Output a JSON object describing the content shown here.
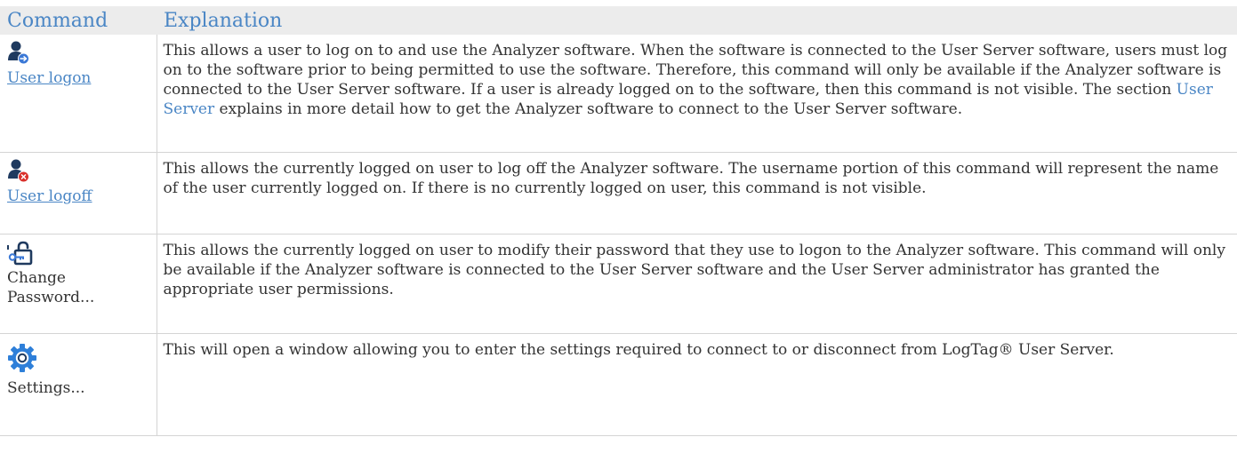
{
  "table": {
    "header": {
      "command": "Command",
      "explanation": "Explanation"
    },
    "rows": [
      {
        "command": "User logon",
        "icon": "user-logon-icon",
        "explanation_before": "This allows a user to log on to and use the Analyzer software. When the software is connected to the User Server software, users must log on to the software prior to being permitted to use the software. Therefore, this command will only be available if the Analyzer software is connected to the User Server software. If a user is already logged on to the software, then this command is not visible. The section ",
        "link": "User Server",
        "explanation_after": " explains in more detail how to get the Analyzer software to connect to the User Server software."
      },
      {
        "command": "User logoff",
        "icon": "user-logoff-icon",
        "explanation": "This allows the currently logged on user to log off the Analyzer software. The username portion of this command will represent the name of the user currently logged on. If there is no currently logged on user, this command is not visible."
      },
      {
        "command": "Change Password...",
        "icon": "change-password-icon",
        "explanation": "This allows the currently logged on user to modify their password that they use to logon to the Analyzer software. This command will only be available if the Analyzer software is connected to the User Server software and the User Server administrator has granted the appropriate user permissions."
      },
      {
        "command": "Settings...",
        "icon": "gear-icon",
        "explanation": "This will open a window allowing you to enter the settings required to connect to or disconnect from LogTag® User Server."
      }
    ]
  },
  "colors": {
    "header_bg": "#ececec",
    "header_text": "#4a86c5",
    "link": "#4a86c5",
    "body_text": "#333333",
    "border": "#d4d4d4",
    "icon_dark": "#1f3a5f",
    "icon_accent": "#3a78d6",
    "icon_error": "#d9302b"
  }
}
